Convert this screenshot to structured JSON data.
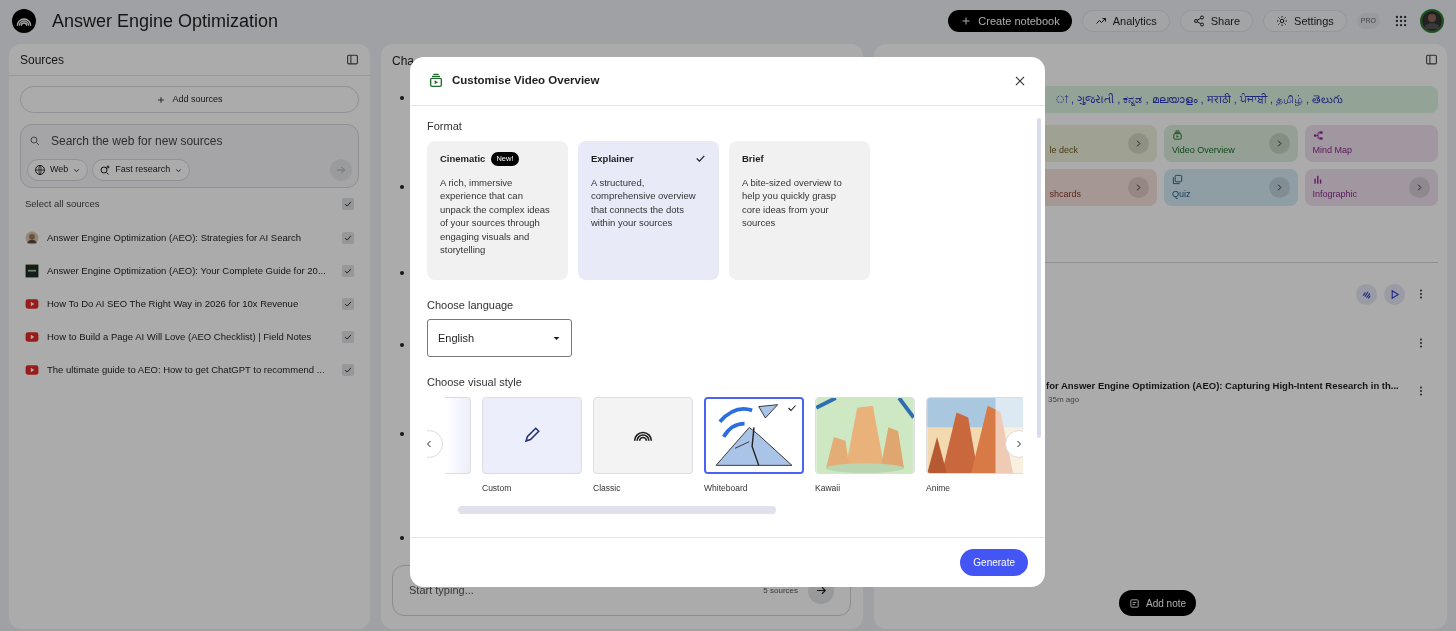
{
  "header": {
    "title": "Answer Engine Optimization",
    "buttons": [
      {
        "kind": "create",
        "label": "Create notebook"
      },
      {
        "kind": "analytics",
        "label": "Analytics"
      },
      {
        "kind": "share",
        "label": "Share"
      },
      {
        "kind": "settings",
        "label": "Settings"
      }
    ],
    "plan_badge": "PRO"
  },
  "sources": {
    "title": "Sources",
    "add_button": "Add sources",
    "search": {
      "placeholder": "Search the web for new sources"
    },
    "chips": [
      {
        "kind": "web",
        "label": "Web"
      },
      {
        "kind": "research",
        "label": "Fast research"
      }
    ],
    "select_all": {
      "label": "Select all sources",
      "checked": true
    },
    "items": [
      {
        "kind": "avatar",
        "title": "Answer Engine Optimization (AEO): Strategies for AI Search",
        "checked": true
      },
      {
        "kind": "logo",
        "title": "Answer Engine Optimization (AEO): Your Complete Guide for 20...",
        "checked": true
      },
      {
        "kind": "video",
        "title": "How To Do AI SEO The Right Way in 2026 for 10x Revenue",
        "checked": true
      },
      {
        "kind": "video",
        "title": "How to Build a Page AI Will Love (AEO Checklist) | Field Notes",
        "checked": true
      },
      {
        "kind": "video",
        "title": "The ultimate guide to AEO: How to get ChatGPT to recommend ...",
        "checked": true
      }
    ]
  },
  "chat": {
    "title": "Cha",
    "input": {
      "placeholder": "Start typing..."
    },
    "source_count": "5 sources"
  },
  "studio": {
    "languages": "া , ગુજરાતી , ಕನ್ನಡ , മലയാളം , मराठी , ਪੰਜਾਬੀ , தமிழ் , తెలుగు",
    "tiles": [
      {
        "kind": "slides",
        "label": "le deck",
        "chevron": true
      },
      {
        "kind": "video",
        "label": "Video Overview",
        "chevron": true
      },
      {
        "kind": "mindmap",
        "label": "Mind Map",
        "chevron": false
      },
      {
        "kind": "flashcards",
        "label": "shcards",
        "chevron": true
      },
      {
        "kind": "quiz",
        "label": "Quiz",
        "chevron": true
      },
      {
        "kind": "infographic",
        "label": "Infographic",
        "chevron": true
      }
    ],
    "note": {
      "title": "for Answer Engine Optimization (AEO): Capturing High-Intent Research in th...",
      "time": "35m ago"
    },
    "add_note": "Add note"
  },
  "modal": {
    "title": "Customise Video Overview",
    "format_label": "Format",
    "formats": [
      {
        "title": "Cinematic",
        "badge": "New!",
        "description": "A rich, immersive experience that can unpack the complex ideas of your sources through engaging visuals and storytelling",
        "selected": false
      },
      {
        "title": "Explainer",
        "description": "A structured, comprehensive overview that connects the dots within your sources",
        "selected": true
      },
      {
        "title": "Brief",
        "description": "A bite-sized overview to help you quickly grasp core ideas from your sources",
        "selected": false
      }
    ],
    "language_label": "Choose language",
    "language": "English",
    "style_label": "Choose visual style",
    "styles": [
      {
        "kind": "partial",
        "selected": false
      },
      {
        "kind": "pencil",
        "label": "Custom",
        "selected": false
      },
      {
        "kind": "logo",
        "label": "Classic",
        "selected": false
      },
      {
        "kind": "whiteboard",
        "label": "Whiteboard",
        "selected": true
      },
      {
        "kind": "kawaii",
        "label": "Kawaii",
        "selected": false
      },
      {
        "kind": "anime",
        "label": "Anime",
        "selected": false
      }
    ],
    "generate": "Generate"
  }
}
